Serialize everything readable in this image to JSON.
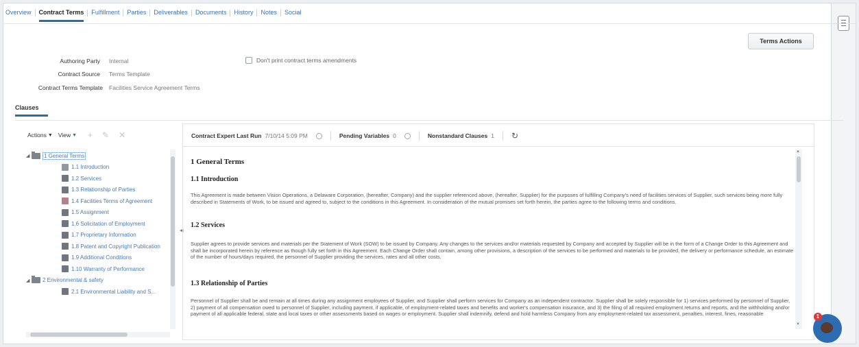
{
  "tabs": [
    "Overview",
    "Contract Terms",
    "Fulfillment",
    "Parties",
    "Deliverables",
    "Documents",
    "History",
    "Notes",
    "Social"
  ],
  "active_tab": "Contract Terms",
  "terms_actions_label": "Terms Actions",
  "fields": {
    "authoring_party": {
      "label": "Authoring Party",
      "value": "Internal"
    },
    "contract_source": {
      "label": "Contract Source",
      "value": "Terms Template"
    },
    "contract_terms_template": {
      "label": "Contract Terms Template",
      "value": "Facilities Service Agreement Terms"
    }
  },
  "dont_print_label": "Don't print contract terms amendments",
  "clauses_tab": "Clauses",
  "tree_toolbar": {
    "actions": "Actions",
    "view": "View"
  },
  "tree": [
    {
      "level": 0,
      "type": "folder",
      "label": "1 General Terms",
      "selected": true
    },
    {
      "level": 1,
      "type": "clause",
      "icon": "intro",
      "label": "1.1 Introduction"
    },
    {
      "level": 1,
      "type": "clause",
      "label": "1.2 Services"
    },
    {
      "level": 1,
      "type": "clause",
      "label": "1.3 Relationship of Parties"
    },
    {
      "level": 1,
      "type": "clause",
      "icon": "special",
      "label": "1.4 Facilities Terms of Agreement"
    },
    {
      "level": 1,
      "type": "clause",
      "label": "1.5 Assignment"
    },
    {
      "level": 1,
      "type": "clause",
      "label": "1.6 Solicitation of Employment"
    },
    {
      "level": 1,
      "type": "clause",
      "label": "1.7 Proprietary Information"
    },
    {
      "level": 1,
      "type": "clause",
      "label": "1.8 Patent and Copyright Publication"
    },
    {
      "level": 1,
      "type": "clause",
      "label": "1.9 Additional Conditions"
    },
    {
      "level": 1,
      "type": "clause",
      "label": "1.10 Warranty of Performance"
    },
    {
      "level": 0,
      "type": "folder",
      "label": "2 Environmental & safety"
    },
    {
      "level": 1,
      "type": "clause",
      "label": "2.1 Environmental Liability and S..."
    }
  ],
  "status_bar": {
    "expert_label": "Contract Expert Last Run",
    "expert_value": "7/10/14 5:09 PM",
    "pending_label": "Pending Variables",
    "pending_value": "0",
    "nonstandard_label": "Nonstandard Clauses",
    "nonstandard_value": "1"
  },
  "document": {
    "h1": "1 General Terms",
    "s1_title": "1.1 Introduction",
    "s1_text": "This Agreement is made between Vision Operations, a Delaware Corporation, (hereafter, Company) and the supplier referenced above, (hereafter, Supplier) for the purposes of fulfilling Company's need of facilities services of Supplier, such services being more fully described in Statements of Work, to be issued and agreed to, subject to the conditions in this Agreement. In consideration of the mutual promises set forth herein, the parties agree to the following terms and conditions.",
    "s2_title": "1.2 Services",
    "s2_text": "Supplier agrees to provide services and materials per the Statement of Work (SOW) to be issued by Company. Any changes to the services and/or materials requested by Company and accepted by Supplier will be in the form of a Change Order to this Agreement and shall be incorporated herein by reference as though fully set forth in this Agreement. Each Change Order shall contain, among other provisions, a description of the services to be performed and materials to be provided, the delivery or performance schedule, an estimate of the number of hours/days required, the personnel of Supplier providing the services, rates and all other costs.",
    "s3_title": "1.3 Relationship of Parties",
    "s3_text": "Personnel of Supplier shall be and remain at all times during any assignment employees of Supplier, and Supplier shall perform services for Company as an independent contractor. Supplier shall be solely responsible for 1) services performed by personnel of Supplier, 2) payment of all compensation owed to personnel of Supplier, including payment, if applicable, of employment-related taxes and benefits and worker's compensation insurance, and 3) the filing of all required employment returns and reports, and the withholding and/or payment of all applicable federal, state and local taxes or other assessments based on wages or employment. Supplier shall indemnify, defend and hold harmless Company from any employment-related tax assessment, penalties, interest, fines, reasonable"
  },
  "chat_badge": "1"
}
